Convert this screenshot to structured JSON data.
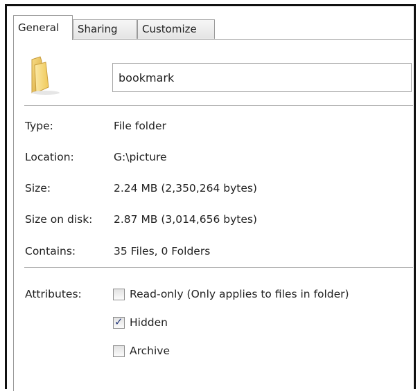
{
  "tabs": [
    {
      "label": "General",
      "active": true
    },
    {
      "label": "Sharing",
      "active": false
    },
    {
      "label": "Customize",
      "active": false
    }
  ],
  "folder_icon": "folder-icon",
  "name_field": {
    "value": "bookmark"
  },
  "properties": {
    "type": {
      "label": "Type:",
      "value": "File folder"
    },
    "location": {
      "label": "Location:",
      "value": "G:\\picture"
    },
    "size": {
      "label": "Size:",
      "value": "2.24 MB (2,350,264 bytes)"
    },
    "size_on_disk": {
      "label": "Size on disk:",
      "value": "2.87 MB (3,014,656 bytes)"
    },
    "contains": {
      "label": "Contains:",
      "value": "35 Files, 0 Folders"
    }
  },
  "attributes": {
    "label": "Attributes:",
    "read_only": {
      "label": "Read-only (Only applies to files in folder)",
      "checked": false
    },
    "hidden": {
      "label": "Hidden",
      "checked": true
    },
    "archive": {
      "label": "Archive",
      "checked": false
    }
  }
}
